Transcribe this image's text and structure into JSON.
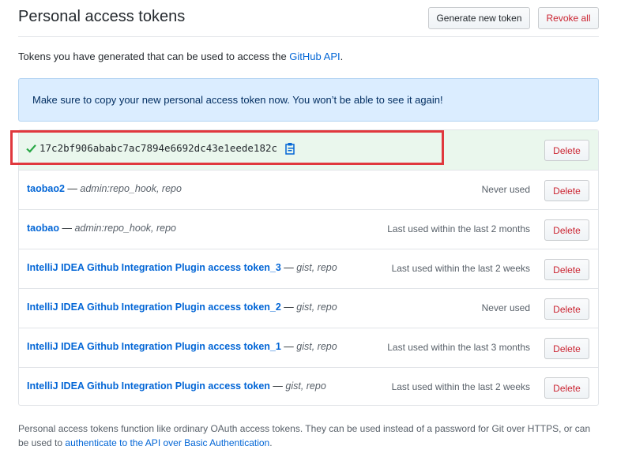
{
  "header": {
    "title": "Personal access tokens",
    "generate_label": "Generate new token",
    "revoke_label": "Revoke all"
  },
  "intro": {
    "text": "Tokens you have generated that can be used to access the ",
    "link": "GitHub API",
    "suffix": "."
  },
  "flash": {
    "message": "Make sure to copy your new personal access token now. You won’t be able to see it again!"
  },
  "new_token": {
    "value": "17c2bf906ababc7ac7894e6692dc43e1eede182c",
    "delete_label": "Delete"
  },
  "tokens": [
    {
      "name": "taobao2",
      "scopes": "admin:repo_hook, repo",
      "last_used": "Never used",
      "delete_label": "Delete"
    },
    {
      "name": "taobao",
      "scopes": "admin:repo_hook, repo",
      "last_used": "Last used within the last 2 months",
      "delete_label": "Delete"
    },
    {
      "name": "IntelliJ IDEA Github Integration Plugin access token_3",
      "scopes": "gist, repo",
      "last_used": "Last used within the last 2 weeks",
      "delete_label": "Delete"
    },
    {
      "name": "IntelliJ IDEA Github Integration Plugin access token_2",
      "scopes": "gist, repo",
      "last_used": "Never used",
      "delete_label": "Delete"
    },
    {
      "name": "IntelliJ IDEA Github Integration Plugin access token_1",
      "scopes": "gist, repo",
      "last_used": "Last used within the last 3 months",
      "delete_label": "Delete"
    },
    {
      "name": "IntelliJ IDEA Github Integration Plugin access token",
      "scopes": "gist, repo",
      "last_used": "Last used within the last 2 weeks",
      "delete_label": "Delete"
    }
  ],
  "footer": {
    "text": "Personal access tokens function like ordinary OAuth access tokens. They can be used instead of a password for Git over HTTPS, or can be used to ",
    "link": "authenticate to the API over Basic Authentication",
    "suffix": "."
  },
  "colors": {
    "link": "#0366d6",
    "danger": "#cb2431",
    "success_bg": "#eaf7ed",
    "flash_bg": "#dbedff",
    "highlight": "#e0383d"
  },
  "icons": {
    "check": "check-icon",
    "clipboard": "clipboard-icon"
  }
}
